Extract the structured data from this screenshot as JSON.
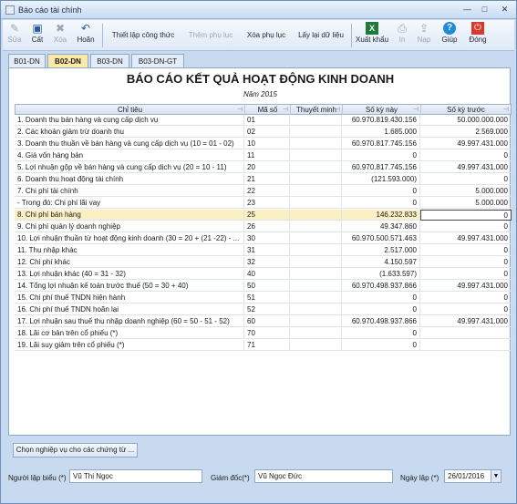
{
  "window": {
    "title": "Báo cáo tài chính",
    "minimize": "—",
    "maximize": "□",
    "close": "✕"
  },
  "toolbar": {
    "sua": "Sửa",
    "cat": "Cất",
    "xoa": "Xóa",
    "hoan": "Hoãn",
    "thiet_lap_cong_thuc": "Thiết lập công thức",
    "them_phu_luc": "Thêm phụ lục",
    "xoa_phu_luc": "Xóa phụ lục",
    "lay_lai_du_lieu": "Lấy lại dữ liệu",
    "xuat_khau": "Xuất khẩu",
    "in": "In",
    "nap": "Nạp",
    "giup": "Giúp",
    "dong": "Đóng",
    "icons": {
      "sua": "✎",
      "cat": "▣",
      "xoa": "✖",
      "hoan": "↶",
      "xuat_khau": "X",
      "in": "⎙",
      "nap": "⇪",
      "giup": "?",
      "dong": "⏻"
    }
  },
  "tabs": [
    "B01-DN",
    "B02-DN",
    "B03-DN",
    "B03-DN-GT"
  ],
  "report": {
    "title": "BÁO CÁO KẾT QUẢ HOẠT ĐỘNG KINH DOANH",
    "year": "Năm 2015"
  },
  "columns": [
    "Chỉ tiêu",
    "Mã số",
    "Thuyết minh",
    "Số kỳ này",
    "Số kỳ trước"
  ],
  "pin_glyph": "⊣",
  "rows": [
    [
      "1. Doanh thu bán hàng và cung cấp dịch vụ",
      "01",
      "",
      "60.970.819.430.156",
      "50.000.000.000"
    ],
    [
      "2. Các khoản giảm trừ doanh thu",
      "02",
      "",
      "1.685.000",
      "2.569.000"
    ],
    [
      "3. Doanh thu thuần về bán hàng và cung cấp dịch vụ (10 = 01 - 02)",
      "10",
      "",
      "60.970.817.745.156",
      "49.997.431.000"
    ],
    [
      "4. Giá vốn hàng bán",
      "11",
      "",
      "0",
      "0"
    ],
    [
      "5. Lợi nhuận gộp về bán hàng và cung cấp dịch vụ (20 = 10 - 11)",
      "20",
      "",
      "60.970.817.745.156",
      "49.997.431.000"
    ],
    [
      "6. Doanh thu hoạt động tài chính",
      "21",
      "",
      "(121.593.000)",
      "0"
    ],
    [
      "7. Chi phí tài chính",
      "22",
      "",
      "0",
      "5.000.000"
    ],
    [
      "- Trong đó: Chi phí lãi vay",
      "23",
      "",
      "0",
      "5.000.000"
    ],
    [
      "8. Chi phí bán hàng",
      "25",
      "",
      "146.232.833",
      "0"
    ],
    [
      "9. Chi phí quản lý doanh nghiệp",
      "26",
      "",
      "49.347.860",
      "0"
    ],
    [
      "10. Lợi nhuận thuần từ hoạt động kinh doanh (30 = 20 + (21 -22) - ...",
      "30",
      "",
      "60.970.500.571.463",
      "49.997.431.000"
    ],
    [
      "11. Thu nhập khác",
      "31",
      "",
      "2.517.000",
      "0"
    ],
    [
      "12. Chi phí khác",
      "32",
      "",
      "4.150.597",
      "0"
    ],
    [
      "13. Lợi nhuận khác (40 = 31 - 32)",
      "40",
      "",
      "(1.633.597)",
      "0"
    ],
    [
      "14. Tổng lợi nhuận kế toán trước thuế (50 = 30 + 40)",
      "50",
      "",
      "60.970.498.937.866",
      "49.997.431.000"
    ],
    [
      "15. Chi phí thuế TNDN hiện hành",
      "51",
      "",
      "0",
      "0"
    ],
    [
      "16. Chi phí thuế TNDN hoãn lại",
      "52",
      "",
      "0",
      "0"
    ],
    [
      "17. Lợi nhuận sau thuế thu nhập doanh nghiệp (60 = 50 - 51 - 52)",
      "60",
      "",
      "60.970.498.937.866",
      "49.997.431.000"
    ],
    [
      "18. Lãi cơ bản trên cổ phiếu (*)",
      "70",
      "",
      "0",
      ""
    ],
    [
      "19. Lãi suy giảm trên cổ phiếu (*)",
      "71",
      "",
      "0",
      ""
    ]
  ],
  "choose_button": "Chọn nghiệp vụ cho các chứng từ ...",
  "footer": {
    "nguoi_lap_label": "Người lập biểu (*)",
    "nguoi_lap": "Vũ Thị Ngọc",
    "giam_doc_label": "Giám đốc(*)",
    "giam_doc": "Vũ Ngọc Đức",
    "ngay_lap_label": "Ngày lập (*)",
    "ngay_lap": "26/01/2016",
    "dropdown_glyph": "▼"
  }
}
